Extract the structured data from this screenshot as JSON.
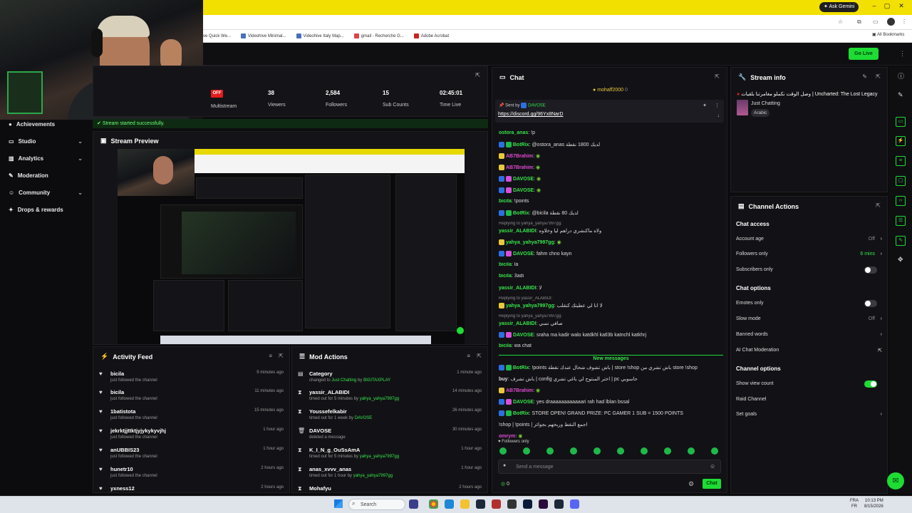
{
  "browser": {
    "gemini_label": "Ask Gemini",
    "bookmarks": [
      "ve Quick We...",
      "Videohive Minimal...",
      "Videohive Italy Map...",
      "gmail - Recherche G...",
      "Adobe Acrobat"
    ],
    "all_bookmarks": "All Bookmarks"
  },
  "top": {
    "go_live": "Go Live"
  },
  "sidebar": {
    "items": [
      {
        "label": "Achievements",
        "icon": "trophy-icon",
        "expand": false
      },
      {
        "label": "Studio",
        "icon": "studio-icon",
        "expand": true
      },
      {
        "label": "Analytics",
        "icon": "analytics-icon",
        "expand": true
      },
      {
        "label": "Moderation",
        "icon": "wrench-icon",
        "expand": false
      },
      {
        "label": "Community",
        "icon": "community-icon",
        "expand": true
      },
      {
        "label": "Drops & rewards",
        "icon": "gift-icon",
        "expand": false
      }
    ]
  },
  "stats": {
    "multistream_badge": "OFF",
    "multistream": "Multistream",
    "viewers_value": "38",
    "viewers": "Viewers",
    "followers_value": "2,584",
    "followers": "Followers",
    "subs_value": "15",
    "subs": "Sub Counts",
    "time_value": "02:45:01",
    "time": "Time Live"
  },
  "toast": "Stream started successfully.",
  "preview": {
    "title": "Stream Preview"
  },
  "activity": {
    "title": "Activity Feed",
    "rows": [
      {
        "name": "bicila",
        "sub": "just followed the channel",
        "time": "9 minutes ago"
      },
      {
        "name": "bicila",
        "sub": "just followed the channel",
        "time": "11 minutes ago"
      },
      {
        "name": "1batistota",
        "sub": "just followed the channel",
        "time": "15 minutes ago"
      },
      {
        "name": "jekrktjjttktjyjykykyvjhj",
        "sub": "just followed the channel",
        "time": "1 hour ago"
      },
      {
        "name": "anUBBIS23",
        "sub": "just followed the channel",
        "time": "1 hour ago"
      },
      {
        "name": "hunetr10",
        "sub": "just followed the channel",
        "time": "2 hours ago"
      },
      {
        "name": "yxness12",
        "sub": "",
        "time": "2 hours ago"
      }
    ]
  },
  "mod": {
    "title": "Mod Actions",
    "rows": [
      {
        "name": "Category",
        "sub": "changed to ",
        "hl": "Just Chatting",
        "by": "BIGITAXPLAY",
        "time": "1 minute ago",
        "icon": "category-icon"
      },
      {
        "name": "yassir_ALABIDI",
        "sub": "timed out for 5 minutes by ",
        "hl": "",
        "by": "yahya_yahya7997gg",
        "time": "14 minutes ago",
        "icon": "hourglass-icon"
      },
      {
        "name": "Youssefelkabir",
        "sub": "timed out for 1 week by ",
        "hl": "",
        "by": "DAVOSE",
        "time": "26 minutes ago",
        "icon": "hourglass-icon"
      },
      {
        "name": "DAVOSE",
        "sub": "deleted a message",
        "hl": "",
        "by": "",
        "time": "30 minutes ago",
        "icon": "trash-icon"
      },
      {
        "name": "K_I_N_g_OuSsAmA",
        "sub": "timed out for 5 minutes by ",
        "hl": "",
        "by": "yahya_yahya7997gg",
        "time": "1 hour ago",
        "icon": "hourglass-icon"
      },
      {
        "name": "anas_xvvv_anas",
        "sub": "timed out for 1 hour by ",
        "hl": "",
        "by": "yahya_yahya7997gg",
        "time": "1 hour ago",
        "icon": "hourglass-icon"
      },
      {
        "name": "Mohafyu",
        "sub": "",
        "hl": "",
        "by": "",
        "time": "2 hours ago",
        "icon": "hourglass-icon"
      }
    ]
  },
  "chat": {
    "title": "Chat",
    "top_user": "mohaff2000",
    "top_count": "0",
    "pinned_by_label": "Sent by",
    "pinned_by": "DAVOSE",
    "pinned_link": "https://discord.gg/96Yx8NarD",
    "messages": [
      {
        "user": "ostora_anas",
        "color": "#38e54a",
        "text": "!p",
        "badges": []
      },
      {
        "user": "BotRix",
        "color": "#38e54a",
        "text": "@ostora_anas لديك 1800 نقطة",
        "badges": [
          "b-blue",
          "b-green"
        ]
      },
      {
        "user": "AB7Brahim",
        "color": "#e04ad1",
        "text": "",
        "badges": [
          "b-yellow"
        ]
      },
      {
        "user": "AB7Brahim",
        "color": "#e04ad1",
        "text": "",
        "badges": [
          "b-yellow"
        ]
      },
      {
        "user": "DAVOSE",
        "color": "#38e54a",
        "text": "",
        "badges": [
          "b-blue",
          "b-pink"
        ]
      },
      {
        "user": "DAVOSE",
        "color": "#38e54a",
        "text": "",
        "badges": [
          "b-blue",
          "b-pink"
        ]
      },
      {
        "user": "bicila",
        "color": "#38e54a",
        "text": "!points",
        "badges": []
      },
      {
        "user": "BotRix",
        "color": "#38e54a",
        "text": "@bicila لديك 80 نقطة",
        "badges": [
          "b-blue",
          "b-green"
        ]
      },
      {
        "user": "yassir_ALABIDI",
        "color": "#38e54a",
        "text": "ولاه ماكنشري دراهم ليا وخلاوه",
        "badges": [],
        "reply": "Replying to yahya_yahya7997gg:"
      },
      {
        "user": "yahya_yahya7997gg",
        "color": "#38e54a",
        "text": "",
        "badges": [
          "b-yellow"
        ]
      },
      {
        "user": "DAVOSE",
        "color": "#38e54a",
        "text": "fahm chno kayn",
        "badges": [
          "b-blue",
          "b-pink"
        ]
      },
      {
        "user": "bicila",
        "color": "#38e54a",
        "text": "la",
        "badges": []
      },
      {
        "user": "bicila",
        "color": "#38e54a",
        "text": "3adi",
        "badges": []
      },
      {
        "user": "yassir_ALABIDI",
        "color": "#38e54a",
        "text": "لا",
        "badges": []
      },
      {
        "user": "yahya_yahya7997gg",
        "color": "#38e54a",
        "text": "لا انا لي عطيتك كنقلب",
        "badges": [
          "b-yellow"
        ],
        "reply": "Replying to yassir_ALABIDI:"
      },
      {
        "user": "yassir_ALABIDI",
        "color": "#38e54a",
        "text": "صافي نسي",
        "badges": [],
        "reply": "Replying to yahya_yahya7997gg:"
      },
      {
        "user": "DAVOSE",
        "color": "#38e54a",
        "text": "sraha ma kadir walo katdkhl katl3b katnchl katkhrj",
        "badges": [
          "b-blue",
          "b-pink"
        ]
      },
      {
        "user": "bicila",
        "color": "#38e54a",
        "text": "wa chat",
        "badges": []
      }
    ],
    "new_messages": "New messages",
    "new": [
      {
        "user": "BotRix",
        "color": "#38e54a",
        "text": "!points باش تشوف شحال عندك نقطة | store !shop باش تشري من store !shop",
        "badges": [
          "b-blue",
          "b-green"
        ]
      },
      {
        "user": "buy",
        "color": "#ddd",
        "text": "باش تشرف | config اختر المنتوج لي باغي تشري | pc حاسوبي",
        "badges": []
      },
      {
        "user": "AB7Brahim",
        "color": "#e04ad1",
        "text": "",
        "badges": [
          "b-yellow"
        ]
      },
      {
        "user": "DAVOSE",
        "color": "#38e54a",
        "text": "yes draaaaaaaaaaaari rah had lblan bssal",
        "badges": [
          "b-blue",
          "b-pink"
        ]
      },
      {
        "user": "BotRix",
        "color": "#38e54a",
        "text": "STORE OPEN! GRAND PRIZE: PC GAMER 1 SUB = 1500 POINTS",
        "badges": [
          "b-blue",
          "b-green"
        ]
      },
      {
        "user": "",
        "color": "#ddd",
        "text": "!shop | !points | اجمع النقط وربحهم بجوائز",
        "badges": []
      },
      {
        "user": "omrym",
        "color": "#e04ad1",
        "text": "",
        "badges": []
      }
    ],
    "followers_only": "Followers only",
    "input_placeholder": "Send a message",
    "count": "0",
    "send_label": "Chat"
  },
  "stream_info": {
    "title": "Stream info",
    "stream_title": "وصل الوقت نكملو مغامرتنا بلقيات | Uncharted: The Lost Legacy",
    "category": "Just Chatting",
    "language": "Arabic"
  },
  "channel_actions": {
    "title": "Channel Actions",
    "sections": [
      {
        "header": "Chat access",
        "items": [
          {
            "label": "Account age",
            "value": "Off",
            "kind": "chevron"
          },
          {
            "label": "Followers only",
            "value": "6 mins",
            "kind": "chevron-green"
          },
          {
            "label": "Subscribers only",
            "value": "",
            "kind": "toggle-off"
          }
        ]
      },
      {
        "header": "Chat options",
        "items": [
          {
            "label": "Emotes only",
            "value": "",
            "kind": "toggle-off"
          },
          {
            "label": "Slow mode",
            "value": "Off",
            "kind": "chevron"
          },
          {
            "label": "Banned words",
            "value": "",
            "kind": "chevron"
          },
          {
            "label": "AI Chat Moderation",
            "value": "",
            "kind": "external"
          }
        ]
      },
      {
        "header": "Channel options",
        "items": [
          {
            "label": "Show view count",
            "value": "",
            "kind": "toggle-on"
          },
          {
            "label": "Raid Channel",
            "value": "",
            "kind": "none"
          },
          {
            "label": "Set goals",
            "value": "",
            "kind": "chevron"
          }
        ]
      }
    ]
  },
  "taskbar": {
    "search": "Search",
    "lang_1": "FRA",
    "lang_2": "FR",
    "time": "10:13 PM",
    "date": "8/15/2026"
  }
}
